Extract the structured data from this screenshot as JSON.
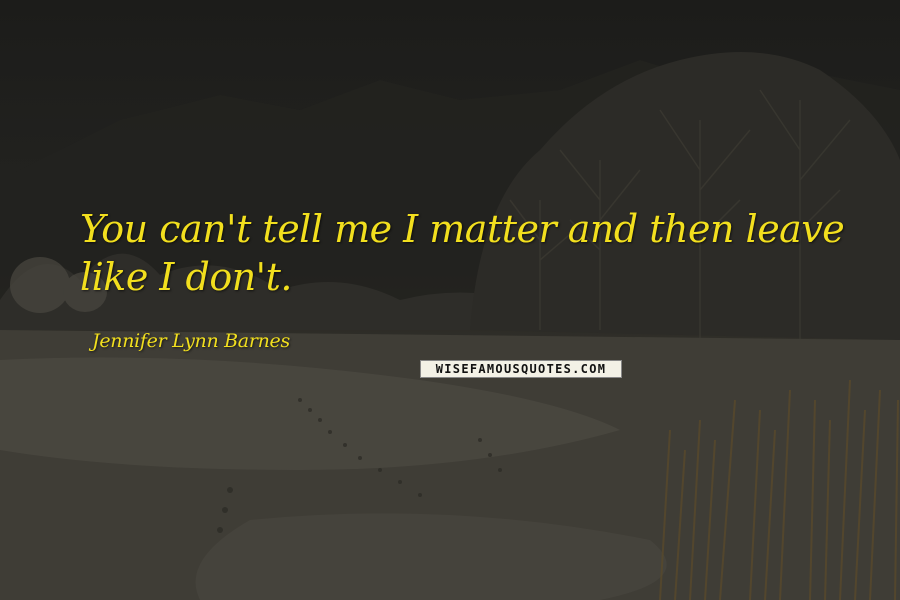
{
  "quote": {
    "text": "You can't tell me I matter and then leave like I don't.",
    "author": "Jennifer Lynn Barnes"
  },
  "watermark": {
    "text": "WISEFAMOUSQUOTES.COM"
  },
  "colors": {
    "quote_text": "#f2df1e",
    "background": "#1f1e1b",
    "badge_bg": "#f3f1e6"
  }
}
